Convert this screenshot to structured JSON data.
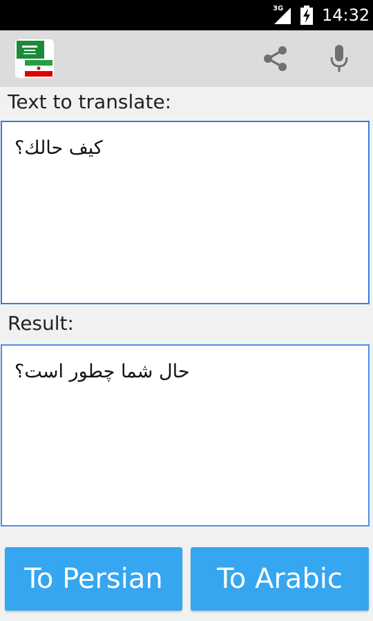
{
  "status_bar": {
    "network": "3G",
    "time": "14:32"
  },
  "action_bar": {
    "logo_icon": "saudi-iran-flags-icon",
    "share_icon": "share-icon",
    "mic_icon": "microphone-icon"
  },
  "input": {
    "label": "Text to translate:",
    "value": "كيف حالك؟"
  },
  "result": {
    "label": "Result:",
    "value": "حال شما چطور است؟"
  },
  "buttons": {
    "to_persian": "To Persian",
    "to_arabic": "To Arabic"
  },
  "colors": {
    "button": "#36a6f0",
    "box_border": "#2f7fe0",
    "action_bar": "#dcdcdc",
    "background": "#f1f1f1"
  }
}
